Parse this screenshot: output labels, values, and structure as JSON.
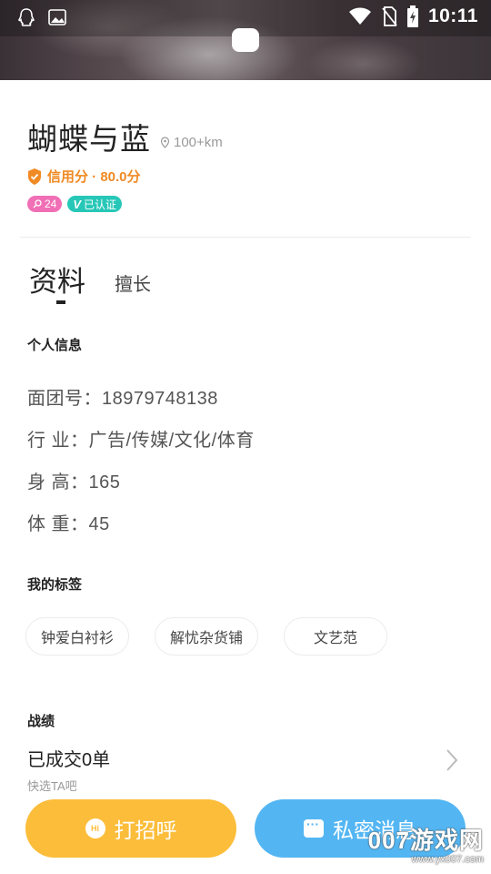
{
  "status_bar": {
    "time": "10:11"
  },
  "profile": {
    "name": "蝴蝶与蓝",
    "distance": "100+km",
    "credit": "信用分 · 80.0分",
    "badge_count": "24",
    "verified": "已认证"
  },
  "tabs": [
    {
      "label": "资料",
      "active": true
    },
    {
      "label": "擅长",
      "active": false
    }
  ],
  "personal_info": {
    "title": "个人信息",
    "rows": [
      "面团号：18979748138",
      "行  业：广告/传媒/文化/体育",
      "身  高：165",
      "体  重：45"
    ]
  },
  "tags_section": {
    "title": "我的标签",
    "tags": [
      "钟爱白衬衫",
      "解忧杂货铺",
      "文艺范"
    ]
  },
  "record": {
    "title": "战绩",
    "main": "已成交0单",
    "sub": "快选TA吧"
  },
  "actions": {
    "greet": "打招呼",
    "greet_icon_text": "Hi",
    "message": "私密消息"
  },
  "watermark": {
    "main": "007游戏网",
    "sub": "www.yx007.com"
  },
  "colors": {
    "credit": "#f08a24",
    "badge_pink": "#f06fb5",
    "badge_teal": "#27c7b7",
    "greet_button": "#fcbd3a",
    "message_button": "#53b6f3"
  }
}
